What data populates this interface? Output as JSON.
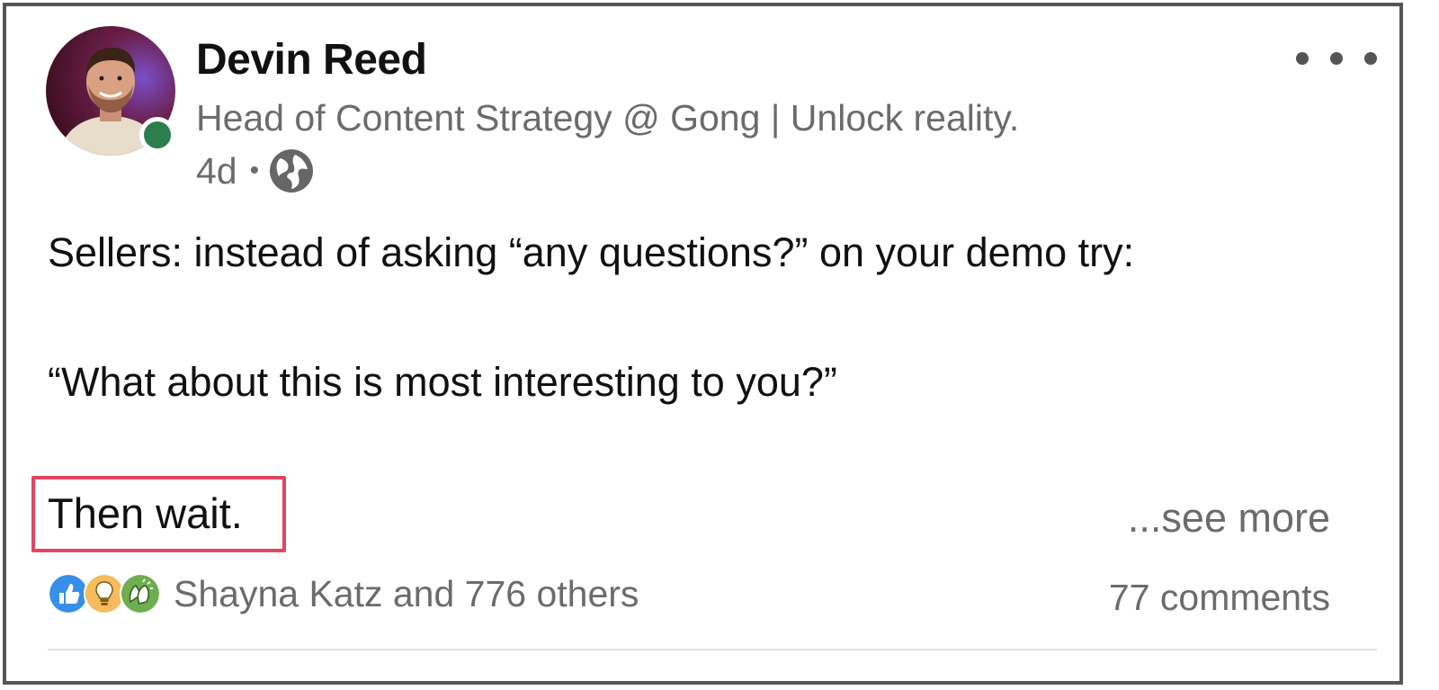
{
  "author": {
    "name": "Devin Reed",
    "headline": "Head of Content Strategy @ Gong | Unlock reality.",
    "time_ago": "4d",
    "separator": "•",
    "visibility_icon": "globe-icon",
    "presence_status": "online",
    "presence_color": "#2e7d4f"
  },
  "menu": {
    "icon": "more-horizontal-icon"
  },
  "post": {
    "lines": [
      "Sellers: instead of asking “any questions?” on your demo try:",
      "“What about this is most interesting to you?”",
      "Then wait."
    ],
    "see_more": "...see more",
    "highlight_color": "#e04661"
  },
  "social": {
    "reaction_icons": [
      "like-icon",
      "insightful-icon",
      "celebrate-icon"
    ],
    "reactions_text": "Shayna Katz and 776 others",
    "comments_text": "77 comments"
  },
  "colors": {
    "text_primary": "#111111",
    "text_secondary": "#6b6b6b",
    "like_blue": "#378fe9",
    "insightful_gold": "#f5bb5c",
    "celebrate_green": "#6dae4f"
  }
}
